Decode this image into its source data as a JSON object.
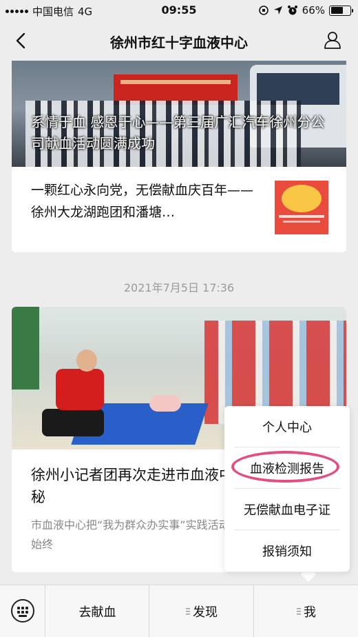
{
  "status_bar": {
    "carrier": "中国电信",
    "network": "4G",
    "time": "09:55",
    "battery": "66%",
    "battery_level": 0.66
  },
  "nav": {
    "title": "徐州市红十字血液中心",
    "back_icon": "chevron-left-icon",
    "user_icon": "user-icon"
  },
  "articles": [
    {
      "hero_title": "系情于血 感恩于心——第三届广汇汽车徐州分公司献血活动圆满成功",
      "items": [
        {
          "title": "一颗红心永向党，无偿献血庆百年——徐州大龙湖跑团和潘塘…"
        }
      ]
    }
  ],
  "timestamp": "2021年7月5日 17:36",
  "article2": {
    "title": "徐州小记者团再次走进市血液中心探索血液奥秘",
    "description": "市血液中心把“我为群众办实事”实践活动本着力点贯穿始终"
  },
  "popup_menu": {
    "items": [
      "个人中心",
      "血液检测报告",
      "无偿献血电子证",
      "报销须知"
    ],
    "highlight_color": "#e34e82"
  },
  "bottom_menu": {
    "keyboard_icon": "keyboard-icon",
    "items": [
      "去献血",
      "发现",
      "我"
    ]
  }
}
